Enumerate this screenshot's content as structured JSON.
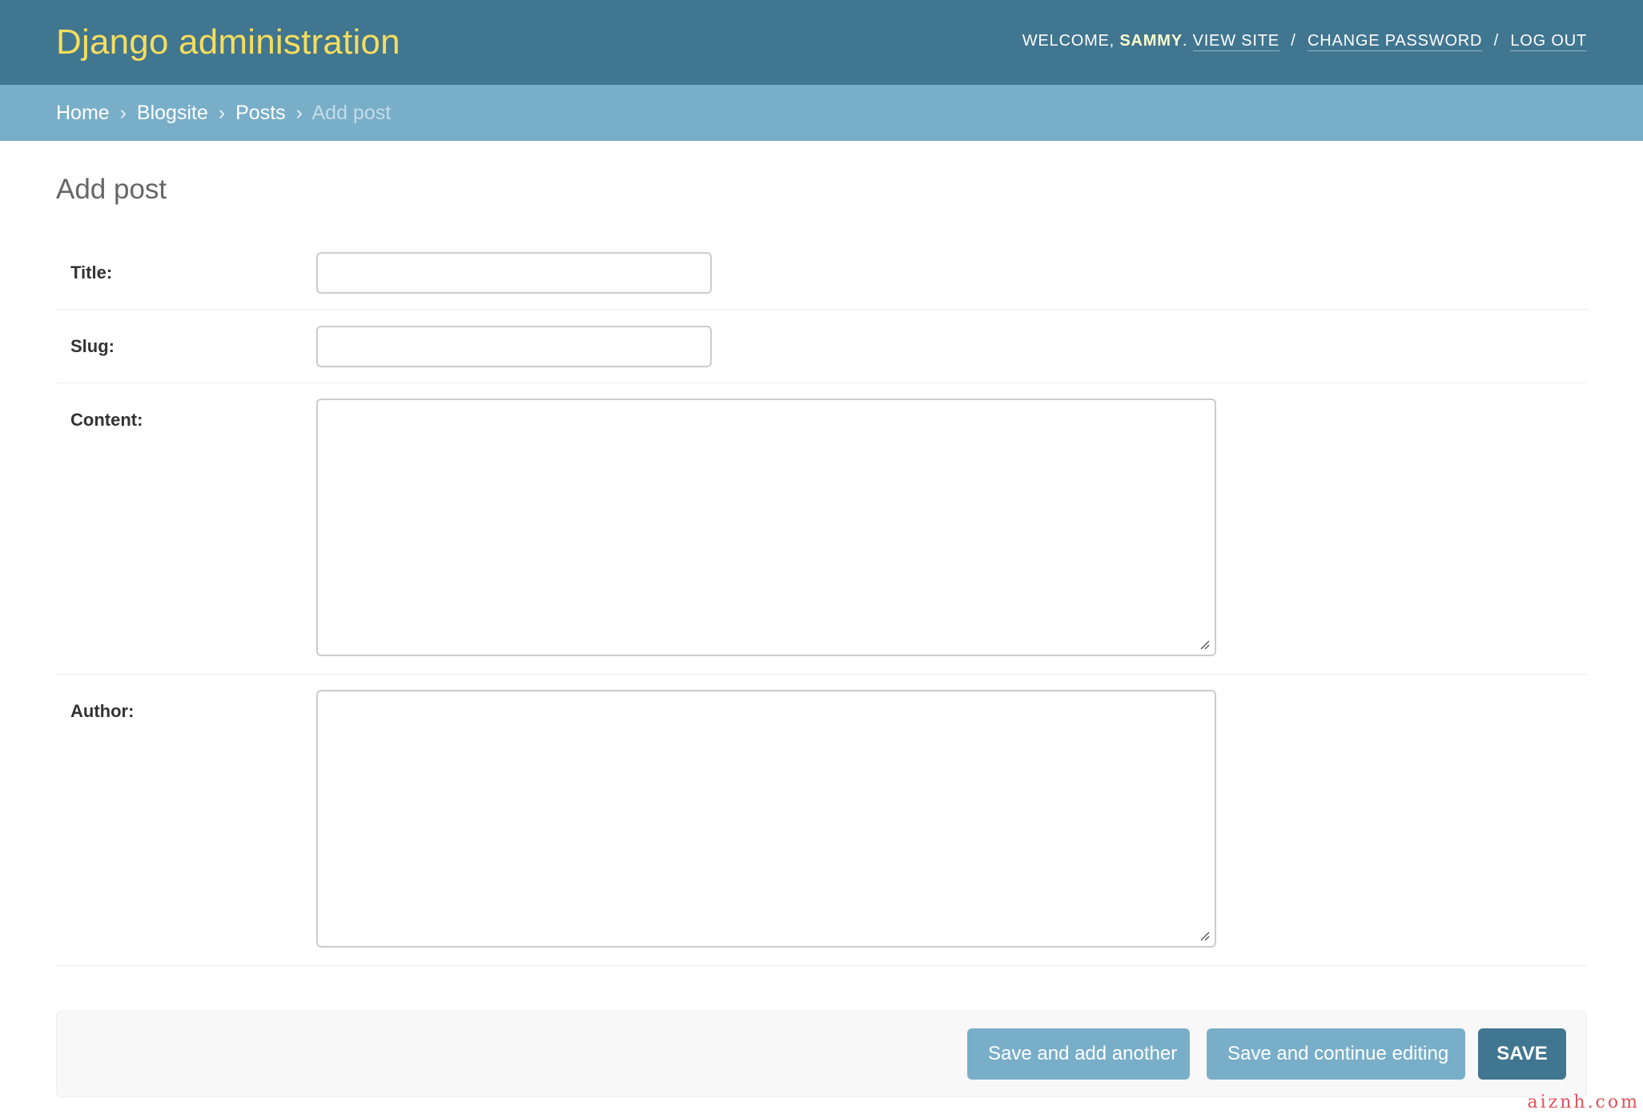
{
  "header": {
    "branding": "Django administration",
    "welcome": "Welcome,",
    "username": "Sammy",
    "view_site": "View site",
    "change_password": "Change password",
    "log_out": "Log out",
    "separator": "/"
  },
  "breadcrumbs": {
    "items": [
      {
        "label": "Home"
      },
      {
        "label": "Blogsite"
      },
      {
        "label": "Posts"
      }
    ],
    "current": "Add post",
    "separator": "›"
  },
  "page": {
    "title": "Add post"
  },
  "form": {
    "fields": [
      {
        "label": "Title:",
        "value": ""
      },
      {
        "label": "Slug:",
        "value": ""
      },
      {
        "label": "Content:",
        "value": ""
      },
      {
        "label": "Author:",
        "value": ""
      }
    ]
  },
  "submit_row": {
    "save_add_another": "Save and add another",
    "save_continue": "Save and continue editing",
    "save": "Save"
  },
  "watermark": "aiznh.com",
  "colors": {
    "header_bg": "#417690",
    "branding": "#f5dd5d",
    "breadcrumbs_bg": "#79aec8",
    "primary_button": "#417690",
    "secondary_button": "#79aec8"
  }
}
